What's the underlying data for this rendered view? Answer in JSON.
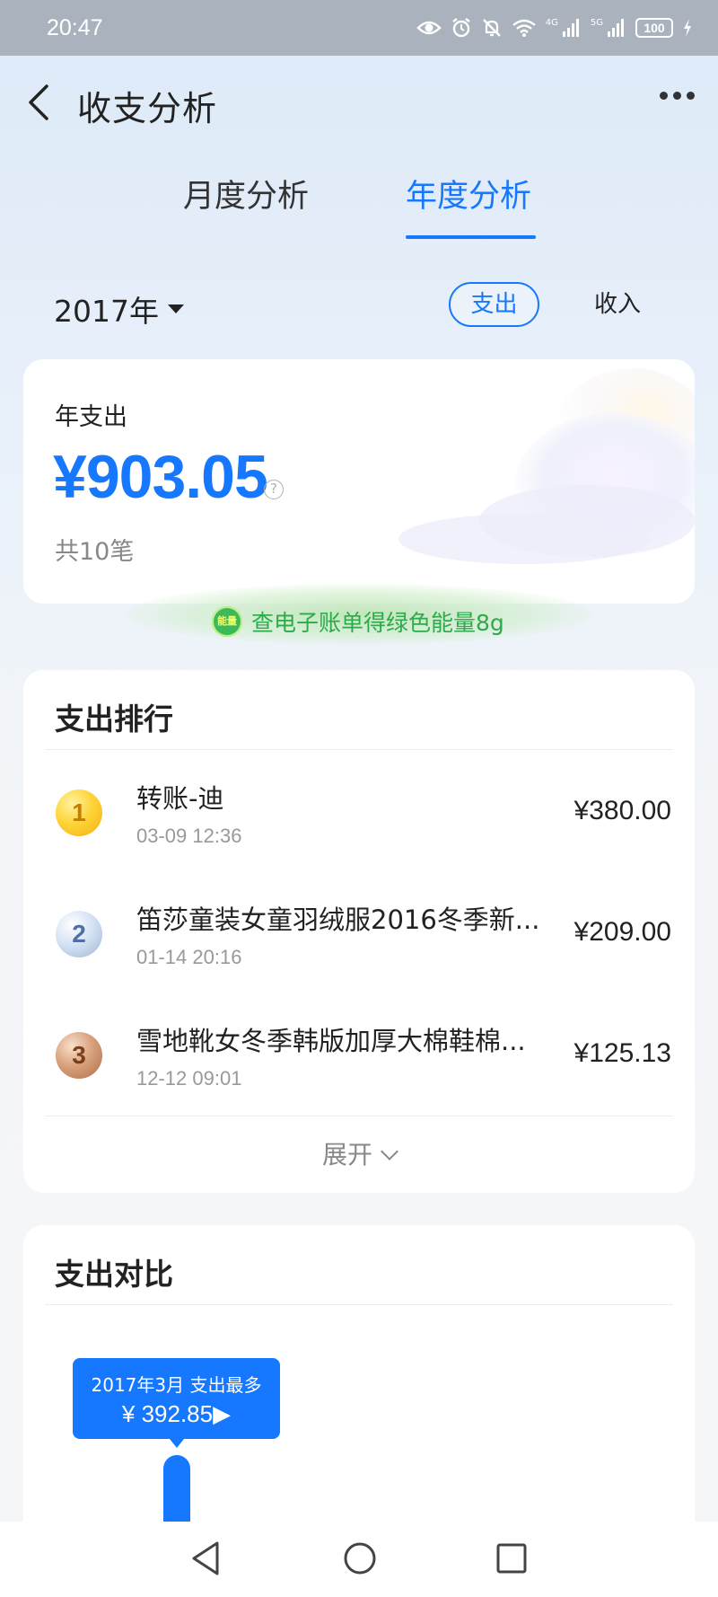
{
  "status_bar": {
    "time": "20:47",
    "net_labels": [
      "4G",
      "5G"
    ],
    "battery": "100",
    "icons": [
      "eye-icon",
      "alarm-icon",
      "mute-icon",
      "wifi-icon",
      "signal-icon",
      "signal-icon",
      "battery-icon",
      "charging-icon"
    ]
  },
  "header": {
    "title": "收支分析",
    "back_icon": "chevron-left-icon",
    "more_icon": "more-dots-icon"
  },
  "tabs": [
    {
      "label": "月度分析",
      "active": false
    },
    {
      "label": "年度分析",
      "active": true
    }
  ],
  "filter": {
    "year": "2017年",
    "expense_label": "支出",
    "income_label": "收入",
    "selected": "支出"
  },
  "annual": {
    "label": "年支出",
    "amount": "¥903.05",
    "count": "共10笔"
  },
  "energy": {
    "badge": "能量",
    "text": "查电子账单得绿色能量8g"
  },
  "ranking": {
    "title": "支出排行",
    "items": [
      {
        "rank": "1",
        "name": "转账-迪",
        "time": "03-09 12:36",
        "amount": "¥380.00"
      },
      {
        "rank": "2",
        "name": "笛莎童装女童羽绒服2016冬季新...",
        "time": "01-14 20:16",
        "amount": "¥209.00"
      },
      {
        "rank": "3",
        "name": "雪地靴女冬季韩版加厚大棉鞋棉...",
        "time": "12-12 09:01",
        "amount": "¥125.13"
      }
    ],
    "expand_label": "展开"
  },
  "compare": {
    "title": "支出对比",
    "tooltip_line1": "2017年3月 支出最多",
    "tooltip_line2": "¥ 392.85▶"
  },
  "nav": {
    "icons": [
      "back-triangle-icon",
      "home-circle-icon",
      "recents-square-icon"
    ]
  },
  "colors": {
    "accent": "#1677ff",
    "energy_green": "#2eaa4c",
    "status_bar": "#aab3bd"
  }
}
